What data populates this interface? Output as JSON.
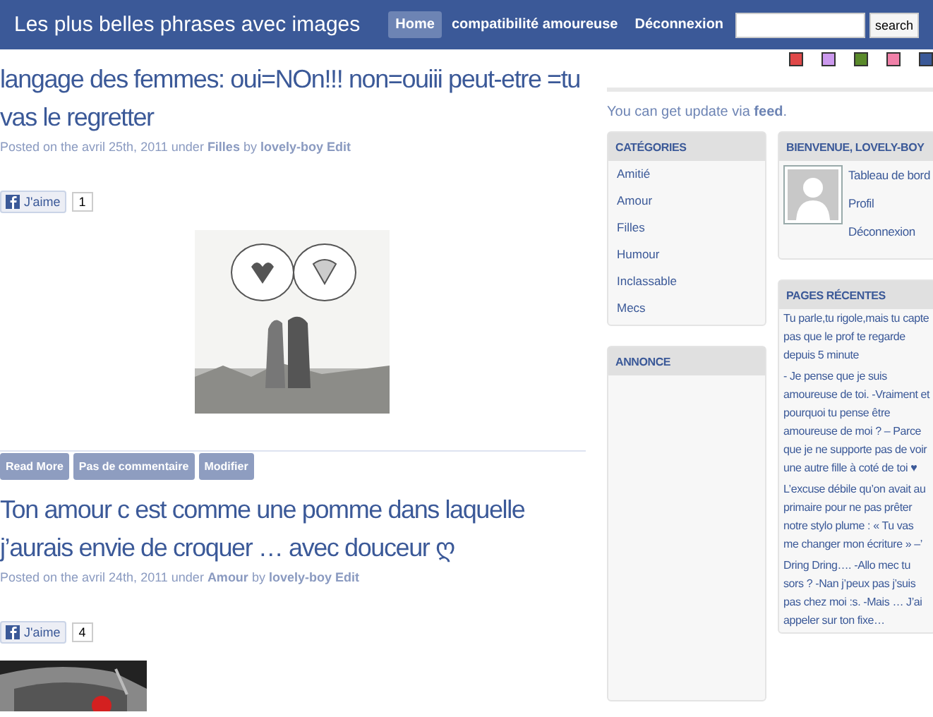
{
  "header": {
    "site_title": "Les plus belles phrases avec images",
    "nav": [
      {
        "label": "Home",
        "selected": true
      },
      {
        "label": "compatibilité amoureuse",
        "selected": false
      },
      {
        "label": "Déconnexion",
        "selected": false
      }
    ],
    "search": {
      "button": "search"
    }
  },
  "color_swatches": [
    {
      "color": "#e04848"
    },
    {
      "color": "#cc99ee"
    },
    {
      "color": "#5a8a2a"
    },
    {
      "color": "#f080a8"
    },
    {
      "color": "#3b5998"
    }
  ],
  "posts": [
    {
      "title": "langage des femmes: oui=NOn!!! non=ouiii peut-etre =tu vas le regretter",
      "meta": "Posted on the avril 25th, 2011 under **Filles** by **lovely-boy Edit**",
      "like": {
        "label": "J'aime",
        "count": "1"
      },
      "image": {
        "kind": "picture"
      },
      "actions": [
        "Read More",
        "Pas de commentaire",
        "Modifier"
      ]
    },
    {
      "title": "Ton amour c est comme une pomme dans laquelle j’aurais envie de croquer … avec douceur ღ",
      "meta": "Posted on the avril 24th, 2011 under **Amour** by **lovely-boy Edit**",
      "like": {
        "label": "J'aime",
        "count": "4"
      },
      "image": {
        "kind": "picture"
      }
    }
  ],
  "sidebar": {
    "feed_note": "You can get update via **feed**.",
    "categories": {
      "title": "CATÉGORIES",
      "items": [
        "Amitié",
        "Amour",
        "Filles",
        "Humour",
        "Inclassable",
        "Mecs"
      ]
    },
    "annonce": {
      "title": "ANNONCE"
    },
    "welcome": {
      "title": "BIENVENUE, LOVELY-BOY",
      "links": [
        "Tableau de bord",
        "Profil",
        "Déconnexion"
      ]
    },
    "recent_pages": {
      "title": "PAGES RÉCENTES",
      "items": [
        "Tu parle,tu rigole,mais tu capte pas que le prof te regarde depuis 5 minute",
        "- Je pense que je suis amoureuse de toi. -Vraiment et pourquoi tu pense être amoureuse de moi ? – Parce que je ne supporte pas de voir une autre fille à coté de toi ♥",
        "L’excuse débile qu’on avait au primaire pour ne pas prêter notre stylo plume : « Tu vas me changer mon écriture » –’",
        "Dring Dring…. -Allo mec tu sors ? -Nan j’peux pas j’suis pas chez moi :s. -Mais … J’ai appeler sur ton fixe…"
      ]
    }
  }
}
